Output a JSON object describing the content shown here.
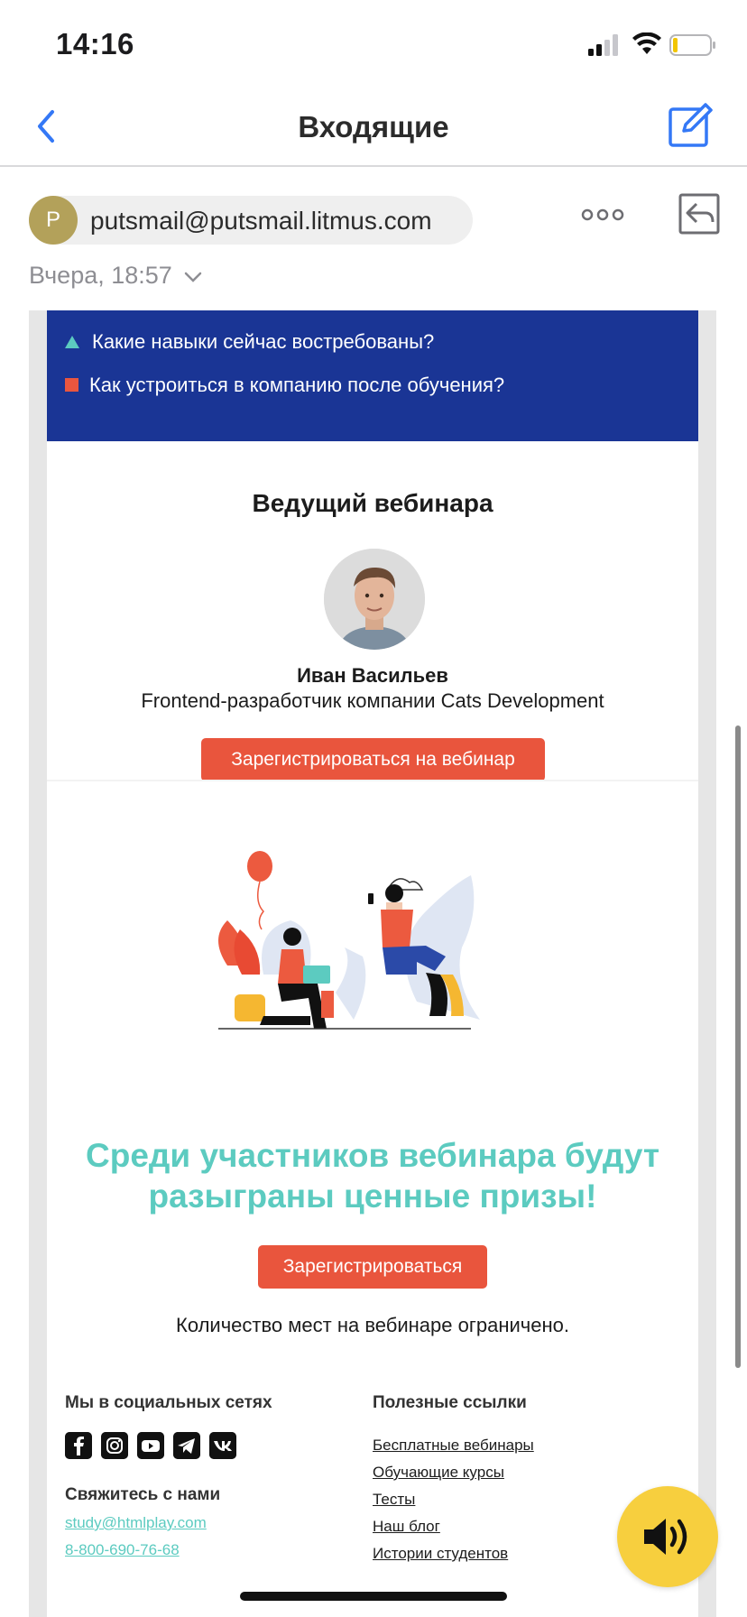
{
  "status": {
    "time": "14:16"
  },
  "nav": {
    "title": "Входящие"
  },
  "message": {
    "sender_initial": "P",
    "sender_email": "putsmail@putsmail.litmus.com",
    "date": "Вчера, 18:57"
  },
  "email": {
    "bullets": [
      {
        "icon": "teal-triangle-icon",
        "text": "Какие навыки сейчас востребованы?"
      },
      {
        "icon": "red-square-icon",
        "text": "Как устроиться в компанию после обучения?"
      }
    ],
    "host_heading": "Ведущий вебинара",
    "host_name": "Иван Васильев",
    "host_role": "Frontend-разработчик компании Cats Development",
    "register_webinar_label": "Зарегистрироваться на вебинар",
    "prize_line1": "Среди участников вебинара будут",
    "prize_line2": "разыграны ценные призы!",
    "register_label": "Зарегистрироваться",
    "limit_text": "Количество мест на вебинаре ограничено.",
    "footer": {
      "social_heading": "Мы в социальных сетях",
      "social_icons": [
        "facebook-icon",
        "instagram-icon",
        "youtube-icon",
        "telegram-icon",
        "vk-icon"
      ],
      "contact_heading": "Свяжитесь с нами",
      "contact_email": "study@htmlplay.com",
      "contact_phone": "8-800-690-76-68",
      "links_heading": "Полезные ссылки",
      "links": [
        "Бесплатные вебинары",
        "Обучающие курсы",
        "Тесты",
        "Наш блог",
        "Истории студентов"
      ]
    }
  },
  "colors": {
    "accent_blue": "#1a3595",
    "button_red": "#e9553d",
    "teal": "#5ccbc0",
    "audio_yellow": "#f7cf3e",
    "ios_blue": "#3478f6"
  }
}
